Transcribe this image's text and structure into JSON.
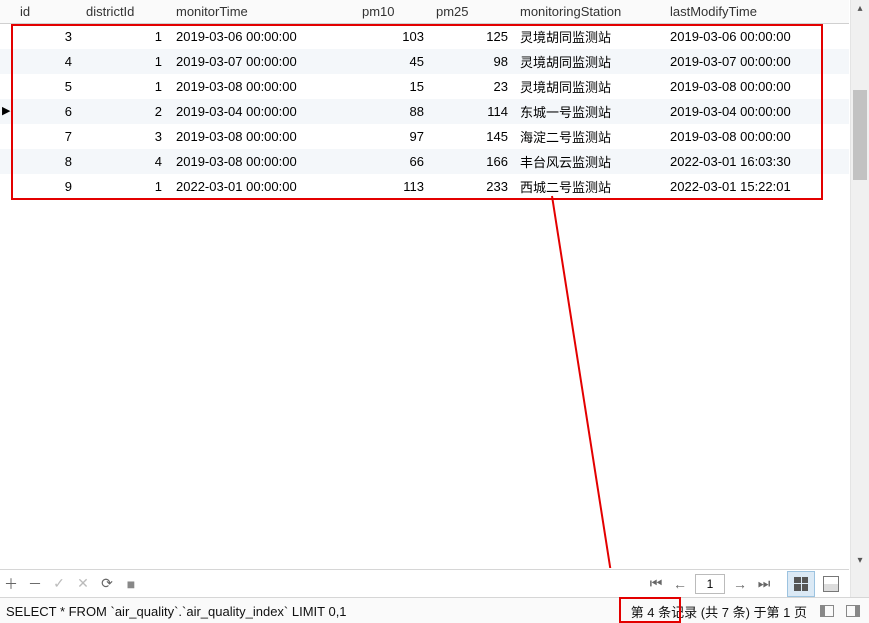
{
  "columns": {
    "id": "id",
    "districtId": "districtId",
    "monitorTime": "monitorTime",
    "pm10": "pm10",
    "pm25": "pm25",
    "monitoringStation": "monitoringStation",
    "lastModifyTime": "lastModifyTime"
  },
  "rows": [
    {
      "id": "3",
      "districtId": "1",
      "monitorTime": "2019-03-06 00:00:00",
      "pm10": "103",
      "pm25": "125",
      "monitoringStation": "灵境胡同监测站",
      "lastModifyTime": "2019-03-06 00:00:00"
    },
    {
      "id": "4",
      "districtId": "1",
      "monitorTime": "2019-03-07 00:00:00",
      "pm10": "45",
      "pm25": "98",
      "monitoringStation": "灵境胡同监测站",
      "lastModifyTime": "2019-03-07 00:00:00"
    },
    {
      "id": "5",
      "districtId": "1",
      "monitorTime": "2019-03-08 00:00:00",
      "pm10": "15",
      "pm25": "23",
      "monitoringStation": "灵境胡同监测站",
      "lastModifyTime": "2019-03-08 00:00:00"
    },
    {
      "id": "6",
      "districtId": "2",
      "monitorTime": "2019-03-04 00:00:00",
      "pm10": "88",
      "pm25": "114",
      "monitoringStation": "东城一号监测站",
      "lastModifyTime": "2019-03-04 00:00:00"
    },
    {
      "id": "7",
      "districtId": "3",
      "monitorTime": "2019-03-08 00:00:00",
      "pm10": "97",
      "pm25": "145",
      "monitoringStation": "海淀二号监测站",
      "lastModifyTime": "2019-03-08 00:00:00"
    },
    {
      "id": "8",
      "districtId": "4",
      "monitorTime": "2019-03-08 00:00:00",
      "pm10": "66",
      "pm25": "166",
      "monitoringStation": "丰台风云监测站",
      "lastModifyTime": "2022-03-01 16:03:30"
    },
    {
      "id": "9",
      "districtId": "1",
      "monitorTime": "2022-03-01 00:00:00",
      "pm10": "113",
      "pm25": "233",
      "monitoringStation": "西城二号监测站",
      "lastModifyTime": "2022-03-01 15:22:01"
    }
  ],
  "icons": {
    "plus": "＋",
    "minus": "－",
    "check": "✓",
    "x": "✕",
    "refresh": "⟳",
    "stop": "■",
    "first": "⏮",
    "prev": "←",
    "next": "→",
    "last": "⏭"
  },
  "paging": {
    "page_value": "1"
  },
  "status": {
    "sql": "SELECT * FROM `air_quality`.`air_quality_index` LIMIT 0,1",
    "rec_prefix": "第 4 条记录",
    "rec_total": "(共 7 条)",
    "rec_suffix": "于第 1 页"
  }
}
